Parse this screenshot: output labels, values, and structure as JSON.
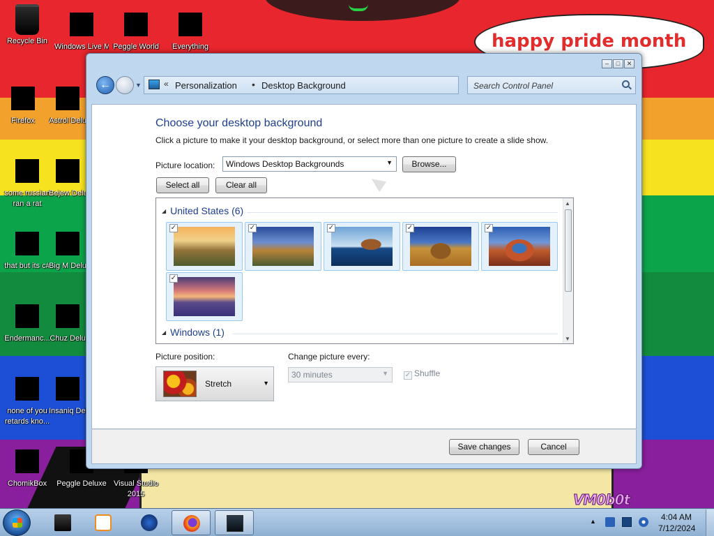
{
  "desktop": {
    "speech_bubble": "happy pride month",
    "watermark": "VM0b0t",
    "icons": [
      {
        "label": "Recycle Bin",
        "icon": "recycle-bin-icon"
      },
      {
        "label": "Windows Live Mai",
        "icon": "windows-live-mail-icon"
      },
      {
        "label": "Peggle World",
        "icon": "peggle-icon"
      },
      {
        "label": "Everything",
        "icon": "everything-icon"
      },
      {
        "label": "Firefox",
        "icon": "firefox-icon"
      },
      {
        "label": "Astrol Delu",
        "icon": "game-icon"
      },
      {
        "label": "some russian ran a rat",
        "icon": "file-icon"
      },
      {
        "label": "Bejew Delu",
        "icon": "game-icon"
      },
      {
        "label": "that but its c#",
        "icon": "file-icon"
      },
      {
        "label": "Big M Delu",
        "icon": "game-icon"
      },
      {
        "label": "Endermanc...",
        "icon": "app-icon"
      },
      {
        "label": "Chuz Delu",
        "icon": "game-icon"
      },
      {
        "label": "none of you retards kno...",
        "icon": "chrome-icon"
      },
      {
        "label": "Insaniq Delu",
        "icon": "game-icon"
      },
      {
        "label": "ChomikBox",
        "icon": "chomikbox-icon"
      },
      {
        "label": "Peggle Deluxe",
        "icon": "peggle-icon"
      },
      {
        "label": "Visual Studio 2015",
        "icon": "visual-studio-icon"
      }
    ]
  },
  "window": {
    "breadcrumb_1": "Personalization",
    "breadcrumb_2": "Desktop Background",
    "breadcrumb_prefix": "«",
    "search_placeholder": "Search Control Panel",
    "title": "Choose your desktop background",
    "description": "Click a picture to make it your desktop background, or select more than one picture to create a slide show.",
    "picture_location_label": "Picture location:",
    "picture_location_value": "Windows Desktop Backgrounds",
    "browse_label": "Browse...",
    "select_all_label": "Select all",
    "clear_all_label": "Clear all",
    "groups": [
      {
        "name": "United States (6)",
        "tiles": 6
      },
      {
        "name": "Windows (1)"
      }
    ],
    "picture_position_label": "Picture position:",
    "picture_position_value": "Stretch",
    "change_picture_label": "Change picture every:",
    "change_picture_value": "30 minutes",
    "shuffle_label": "Shuffle",
    "save_label": "Save changes",
    "cancel_label": "Cancel"
  },
  "taskbar": {
    "items": [
      "explorer",
      "media-player",
      "game",
      "firefox",
      "control-panel"
    ],
    "time": "4:04 AM",
    "date": "7/12/2024"
  },
  "colors": {
    "accent": "#1e3f8f",
    "window_frame": "#bfd8ef"
  }
}
